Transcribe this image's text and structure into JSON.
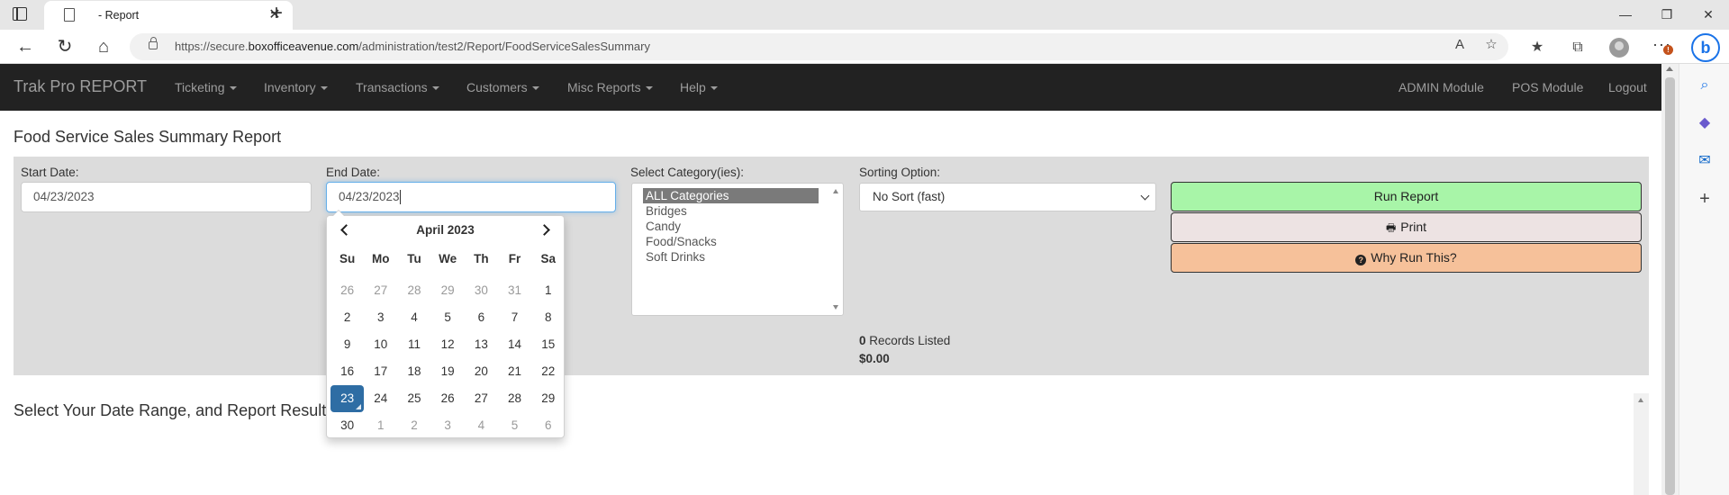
{
  "browser": {
    "tab_title": "- Report",
    "url_prefix": "https://secure.",
    "url_host": "boxofficeavenue.com",
    "url_path": "/administration/test2/Report/FoodServiceSalesSummary",
    "bing_label": "b",
    "alert_count": "!"
  },
  "nav": {
    "brand": "Trak Pro REPORT",
    "menus": [
      "Ticketing",
      "Inventory",
      "Transactions",
      "Customers",
      "Misc Reports",
      "Help"
    ],
    "right_links": [
      "ADMIN Module",
      "POS Module",
      "Logout"
    ]
  },
  "report": {
    "title": "Food Service Sales Summary Report",
    "start_label": "Start Date:",
    "start_value": "04/23/2023",
    "end_label": "End Date:",
    "end_value": "04/23/2023",
    "category_label": "Select Category(ies):",
    "categories": [
      "ALL Categories",
      "Bridges",
      "Candy",
      "Food/Snacks",
      "Soft Drinks"
    ],
    "sort_label": "Sorting Option:",
    "sort_value": "No Sort (fast)",
    "run_label": "Run Report",
    "print_label": "Print",
    "why_label": "Why Run This?",
    "records_count": "0",
    "records_suffix": " Records Listed",
    "total": "$0.00",
    "result_message": "Select Your Date Range, and Report Results"
  },
  "calendar": {
    "month_title": "April 2023",
    "days_of_week": [
      "Su",
      "Mo",
      "Tu",
      "We",
      "Th",
      "Fr",
      "Sa"
    ],
    "weeks": [
      [
        "26",
        "27",
        "28",
        "29",
        "30",
        "31",
        "1"
      ],
      [
        "2",
        "3",
        "4",
        "5",
        "6",
        "7",
        "8"
      ],
      [
        "9",
        "10",
        "11",
        "12",
        "13",
        "14",
        "15"
      ],
      [
        "16",
        "17",
        "18",
        "19",
        "20",
        "21",
        "22"
      ],
      [
        "23",
        "24",
        "25",
        "26",
        "27",
        "28",
        "29"
      ],
      [
        "30",
        "1",
        "2",
        "3",
        "4",
        "5",
        "6"
      ]
    ],
    "selected_day": "23"
  },
  "colors": {
    "navbar": "#222222",
    "panel": "#dcdcdc",
    "run_button": "#a8f5a8",
    "print_button": "#ede3e3",
    "why_button": "#f6c19a",
    "selected_day": "#2e6da4"
  }
}
